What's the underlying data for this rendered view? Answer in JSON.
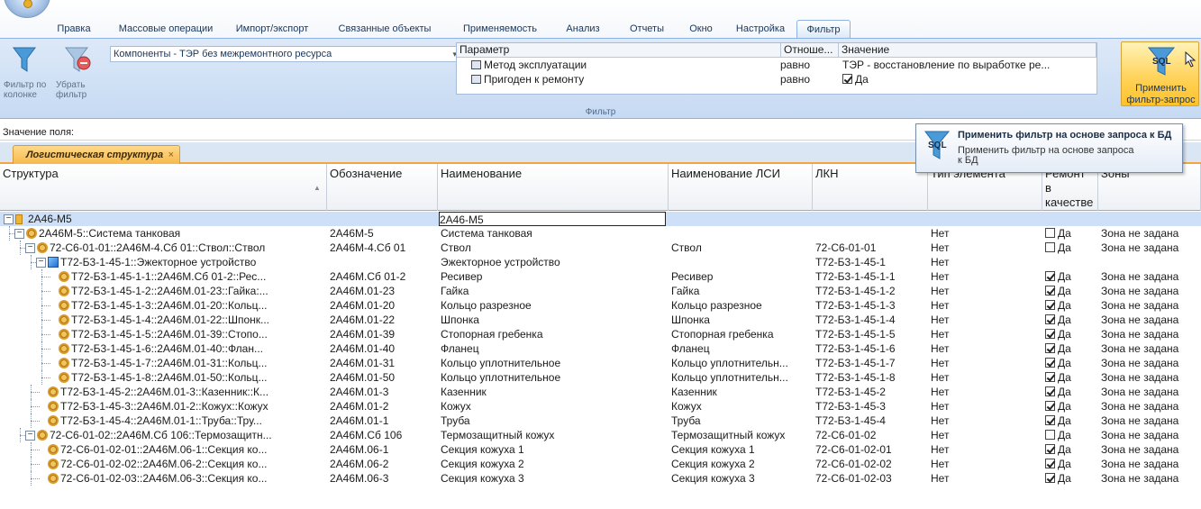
{
  "ribbon": {
    "tabs": [
      "Правка",
      "Массовые операции",
      "Импорт/экспорт",
      "Связанные объекты",
      "Применяемость",
      "Анализ",
      "Отчеты",
      "Окно",
      "Настройка",
      "Фильтр"
    ],
    "active_tab": "Фильтр",
    "filter_by_column_label": "Фильтр по колонке",
    "remove_filter_label": "Убрать фильтр",
    "component_combo_value": "Компоненты - ТЭР без межремонтного ресурса",
    "filter_grid": {
      "headers": [
        "Параметр",
        "Отноше...",
        "Значение"
      ],
      "rows": [
        {
          "param": "Метод эксплуатации",
          "relation": "равно",
          "value": "ТЭР - восстановление по выработке ре..."
        },
        {
          "param": "Пригоден к ремонту",
          "relation": "равно",
          "value": "Да"
        }
      ]
    },
    "group_label": "Фильтр",
    "apply_sql_label": "Применить фильтр-запрос",
    "sql_icon_text": "SQL"
  },
  "field_value_label": "Значение поля:",
  "doc_tab": {
    "label": "Логистическая структура",
    "close": "×"
  },
  "tooltip": {
    "title": "Применить фильтр на основе запроса к БД",
    "description": "Применить фильтр на основе запроса к БД"
  },
  "grid": {
    "columns": [
      "Структура",
      "Обозначение",
      "Наименование",
      "Наименование ЛСИ",
      "ЛКН",
      "Тип элемента",
      "Ремонт в качестве",
      "Зоны"
    ],
    "rows": [
      {
        "structure": "2А46-М5",
        "designation": "",
        "name": "2А46-М5",
        "lsi_name": "",
        "lkn": "",
        "type": "",
        "repair": "",
        "zone": ""
      },
      {
        "structure": "2А46М-5::Система танковая",
        "designation": "2А46М-5",
        "name": "Система танковая",
        "lsi_name": "",
        "lkn": "",
        "type": "Нет",
        "repair": "Да",
        "zone": "Зона не задана"
      },
      {
        "structure": "72-С6-01-01::2А46М-4.Сб 01::Ствол::Ствол",
        "designation": "2А46М-4.Сб 01",
        "name": "Ствол",
        "lsi_name": "Ствол",
        "lkn": "72-С6-01-01",
        "type": "Нет",
        "repair": "Да",
        "zone": "Зона не задана"
      },
      {
        "structure": "Т72-Б3-1-45-1::Эжекторное устройство",
        "designation": "",
        "name": "Эжекторное устройство",
        "lsi_name": "",
        "lkn": "Т72-Б3-1-45-1",
        "type": "Нет",
        "repair": "",
        "zone": ""
      },
      {
        "structure": "Т72-Б3-1-45-1-1::2А46М.Сб 01-2::Рес...",
        "designation": "2А46М.Сб 01-2",
        "name": "Ресивер",
        "lsi_name": "Ресивер",
        "lkn": "Т72-Б3-1-45-1-1",
        "type": "Нет",
        "repair": "Да",
        "zone": "Зона не задана"
      },
      {
        "structure": "Т72-Б3-1-45-1-2::2А46М.01-23::Гайка:...",
        "designation": "2А46М.01-23",
        "name": "Гайка",
        "lsi_name": "Гайка",
        "lkn": "Т72-Б3-1-45-1-2",
        "type": "Нет",
        "repair": "Да",
        "zone": "Зона не задана"
      },
      {
        "structure": "Т72-Б3-1-45-1-3::2А46М.01-20::Кольц...",
        "designation": "2А46М.01-20",
        "name": "Кольцо разрезное",
        "lsi_name": "Кольцо разрезное",
        "lkn": "Т72-Б3-1-45-1-3",
        "type": "Нет",
        "repair": "Да",
        "zone": "Зона не задана"
      },
      {
        "structure": "Т72-Б3-1-45-1-4::2А46М.01-22::Шпонк...",
        "designation": "2А46М.01-22",
        "name": "Шпонка",
        "lsi_name": "Шпонка",
        "lkn": "Т72-Б3-1-45-1-4",
        "type": "Нет",
        "repair": "Да",
        "zone": "Зона не задана"
      },
      {
        "structure": "Т72-Б3-1-45-1-5::2А46М.01-39::Стопо...",
        "designation": "2А46М.01-39",
        "name": "Стопорная гребенка",
        "lsi_name": "Стопорная гребенка",
        "lkn": "Т72-Б3-1-45-1-5",
        "type": "Нет",
        "repair": "Да",
        "zone": "Зона не задана"
      },
      {
        "structure": "Т72-Б3-1-45-1-6::2А46М.01-40::Флан...",
        "designation": "2А46М.01-40",
        "name": "Фланец",
        "lsi_name": "Фланец",
        "lkn": "Т72-Б3-1-45-1-6",
        "type": "Нет",
        "repair": "Да",
        "zone": "Зона не задана"
      },
      {
        "structure": "Т72-Б3-1-45-1-7::2А46М.01-31::Кольц...",
        "designation": "2А46М.01-31",
        "name": "Кольцо уплотнительное",
        "lsi_name": "Кольцо уплотнительн...",
        "lkn": "Т72-Б3-1-45-1-7",
        "type": "Нет",
        "repair": "Да",
        "zone": "Зона не задана"
      },
      {
        "structure": "Т72-Б3-1-45-1-8::2А46М.01-50::Кольц...",
        "designation": "2А46М.01-50",
        "name": "Кольцо уплотнительное",
        "lsi_name": "Кольцо уплотнительн...",
        "lkn": "Т72-Б3-1-45-1-8",
        "type": "Нет",
        "repair": "Да",
        "zone": "Зона не задана"
      },
      {
        "structure": "Т72-Б3-1-45-2::2А46М.01-3::Казенник::К...",
        "designation": "2А46М.01-3",
        "name": "Казенник",
        "lsi_name": "Казенник",
        "lkn": "Т72-Б3-1-45-2",
        "type": "Нет",
        "repair": "Да",
        "zone": "Зона не задана"
      },
      {
        "structure": "Т72-Б3-1-45-3::2А46М.01-2::Кожух::Кожух",
        "designation": "2А46М.01-2",
        "name": "Кожух",
        "lsi_name": "Кожух",
        "lkn": "Т72-Б3-1-45-3",
        "type": "Нет",
        "repair": "Да",
        "zone": "Зона не задана"
      },
      {
        "structure": "Т72-Б3-1-45-4::2А46М.01-1::Труба::Тру...",
        "designation": "2А46М.01-1",
        "name": "Труба",
        "lsi_name": "Труба",
        "lkn": "Т72-Б3-1-45-4",
        "type": "Нет",
        "repair": "Да",
        "zone": "Зона не задана"
      },
      {
        "structure": "72-С6-01-02::2А46М.Сб 106::Термозащитн...",
        "designation": "2А46М.Сб 106",
        "name": "Термозащитный кожух",
        "lsi_name": "Термозащитный кожух",
        "lkn": "72-С6-01-02",
        "type": "Нет",
        "repair": "Да",
        "zone": "Зона не задана"
      },
      {
        "structure": "72-С6-01-02-01::2А46М.06-1::Секция ко...",
        "designation": "2А46М.06-1",
        "name": "Секция кожуха 1",
        "lsi_name": "Секция кожуха 1",
        "lkn": "72-С6-01-02-01",
        "type": "Нет",
        "repair": "Да",
        "zone": "Зона не задана"
      },
      {
        "structure": "72-С6-01-02-02::2А46М.06-2::Секция ко...",
        "designation": "2А46М.06-2",
        "name": "Секция кожуха 2",
        "lsi_name": "Секция кожуха 2",
        "lkn": "72-С6-01-02-02",
        "type": "Нет",
        "repair": "Да",
        "zone": "Зона не задана"
      },
      {
        "structure": "72-С6-01-02-03::2А46М.06-3::Секция ко...",
        "designation": "2А46М.06-3",
        "name": "Секция кожуха 3",
        "lsi_name": "Секция кожуха 3",
        "lkn": "72-С6-01-02-03",
        "type": "Нет",
        "repair": "Да",
        "zone": "Зона не задана"
      }
    ]
  },
  "colors": {
    "ribbon_bg": "#c6daf3",
    "selection": "#cde0f7",
    "accent_orange": "#f4a63d",
    "apply_button": "#ffd35c"
  }
}
